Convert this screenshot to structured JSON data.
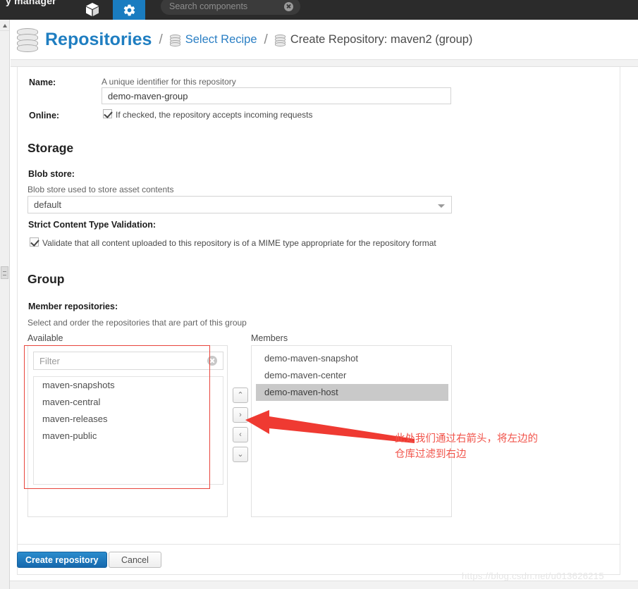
{
  "topbar": {
    "app_title": "y manager",
    "nav_icons": [
      "box-icon",
      "gear-icon"
    ],
    "search": {
      "placeholder": "Search components",
      "value": "",
      "clear_icon": "clear-icon"
    }
  },
  "breadcrumb": {
    "root_label": "Repositories",
    "separator": "/",
    "items": [
      {
        "label": "Select Recipe",
        "icon": "repository-icon",
        "link": true
      },
      {
        "label": "Create Repository: maven2 (group)",
        "icon": "repository-icon",
        "link": false
      }
    ]
  },
  "form": {
    "name": {
      "label": "Name:",
      "help": "A unique identifier for this repository",
      "value": "demo-maven-group",
      "placeholder": ""
    },
    "online": {
      "label": "Online:",
      "checkbox_text": "If checked, the repository accepts incoming requests",
      "checked": true
    },
    "storage": {
      "section_title": "Storage",
      "blob_store": {
        "label": "Blob store:",
        "help": "Blob store used to store asset contents",
        "selected": "default",
        "options": [
          "default"
        ],
        "caret_icon": "chevron-down-icon"
      },
      "strict_validation": {
        "label": "Strict Content Type Validation:",
        "checkbox_text": "Validate that all content uploaded to this repository is of a MIME type appropriate for the repository format",
        "checked": true
      }
    },
    "group": {
      "section_title": "Group",
      "member_label": "Member repositories:",
      "member_help": "Select and order the repositories that are part of this group",
      "available": {
        "column_label": "Available",
        "filter_placeholder": "Filter",
        "filter_value": "",
        "clear_icon": "clear-icon",
        "items": [
          "maven-snapshots",
          "maven-central",
          "maven-releases",
          "maven-public"
        ]
      },
      "members": {
        "column_label": "Members",
        "items": [
          {
            "label": "demo-maven-snapshot",
            "selected": false
          },
          {
            "label": "demo-maven-center",
            "selected": false
          },
          {
            "label": "demo-maven-host",
            "selected": true
          }
        ]
      },
      "transfer_buttons": [
        {
          "name": "move-up-button",
          "glyph": "⌃"
        },
        {
          "name": "move-right-button",
          "glyph": "›"
        },
        {
          "name": "move-left-button",
          "glyph": "‹"
        },
        {
          "name": "move-down-button",
          "glyph": "⌄"
        }
      ]
    }
  },
  "footer": {
    "primary_label": "Create repository",
    "secondary_label": "Cancel"
  },
  "annotation": {
    "text": "此处我们通过右箭头，将左边的\n仓库过滤到右边",
    "color": "#f1534a"
  },
  "watermark": {
    "text": "https://blog.csdn.net/u013626215"
  },
  "colors": {
    "accent_blue": "#1f7ec1",
    "nav_dark": "#2b2b2b",
    "annotation_red": "#e8453c",
    "selected_row": "#c9c9c9"
  }
}
